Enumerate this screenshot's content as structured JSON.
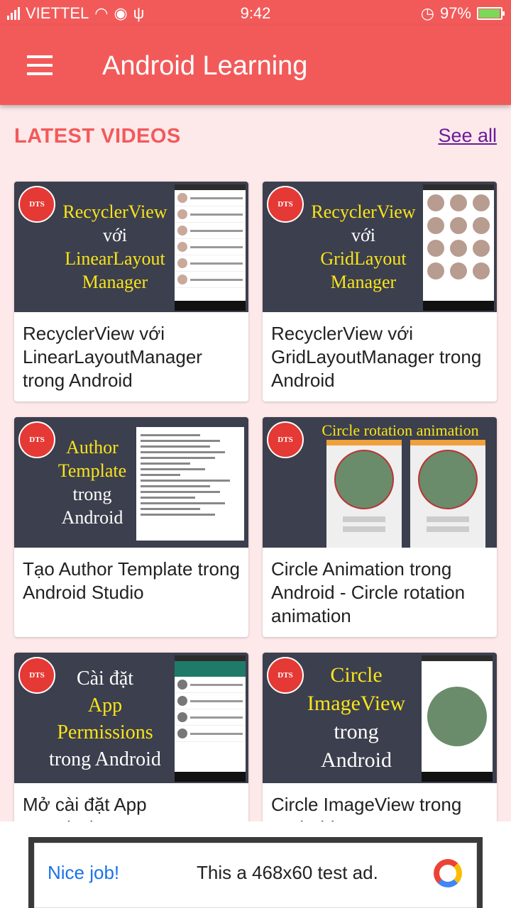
{
  "status": {
    "carrier": "VIETTEL",
    "time": "9:42",
    "battery": "97%"
  },
  "appbar": {
    "title": "Android Learning"
  },
  "section": {
    "title": "LATEST VIDEOS",
    "see_all": "See all"
  },
  "cards": [
    {
      "title": "RecyclerView với LinearLayoutManager trong Android",
      "thumb_lines": [
        "RecyclerView",
        "với",
        "LinearLayout",
        "Manager"
      ]
    },
    {
      "title": "RecyclerView với GridLayoutManager trong Android",
      "thumb_lines": [
        "RecyclerView",
        "với",
        "GridLayout",
        "Manager"
      ]
    },
    {
      "title": "Tạo Author Template trong Android Studio",
      "thumb_lines": [
        "Author",
        "Template",
        "trong",
        "Android"
      ]
    },
    {
      "title": "Circle Animation trong Android - Circle rotation animation",
      "thumb_lines": [
        "Circle rotation animation"
      ]
    },
    {
      "title": "Mở cài đặt App Permissions",
      "thumb_lines": [
        "Cài đặt",
        "App",
        "Permissions",
        "trong Android"
      ]
    },
    {
      "title": "Circle ImageView trong Android",
      "thumb_lines": [
        "Circle",
        "ImageView",
        "trong",
        "Android"
      ]
    }
  ],
  "logo": "DTS",
  "ad": {
    "left": "Nice job!",
    "text": "This a 468x60 test ad."
  }
}
